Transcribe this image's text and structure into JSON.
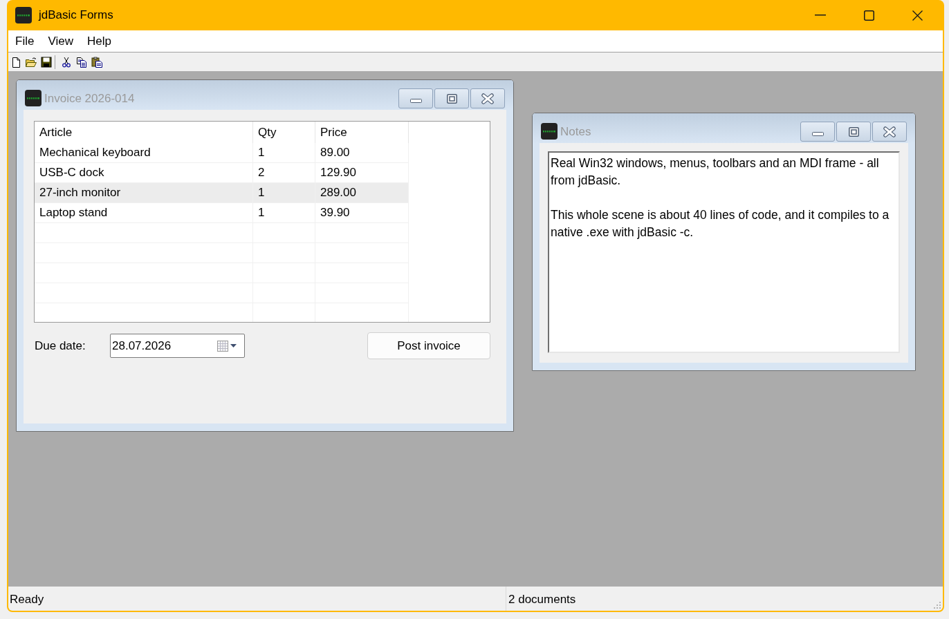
{
  "window": {
    "title": "jdBasic Forms"
  },
  "menu_bar": {
    "items": [
      "File",
      "View",
      "Help"
    ]
  },
  "mdi_windows": [
    {
      "kind": "invoice",
      "title": "Invoice 2026-014",
      "active": false,
      "table": {
        "columns": [
          "Article",
          "Qty",
          "Price"
        ],
        "rows": [
          {
            "cells": [
              "Mechanical keyboard",
              "1",
              "89.00"
            ],
            "selected": false
          },
          {
            "cells": [
              "USB-C dock",
              "2",
              "129.90"
            ],
            "selected": false
          },
          {
            "cells": [
              "27-inch monitor",
              "1",
              "289.00"
            ],
            "selected": true
          },
          {
            "cells": [
              "Laptop stand",
              "1",
              "39.90"
            ],
            "selected": false
          }
        ]
      },
      "due_date": {
        "label": "Due date:",
        "value": "28.07.2026"
      },
      "button": "Post invoice"
    },
    {
      "kind": "notes",
      "title": "Notes",
      "active": false,
      "paragraphs": [
        "Real Win32 windows, menus, toolbars and an MDI frame - all from jdBasic.",
        "This whole scene is about 40 lines of code, and it compiles to a native .exe with jdBasic -c."
      ]
    }
  ],
  "status_bar": {
    "panels": [
      "Ready",
      "2 documents"
    ]
  }
}
